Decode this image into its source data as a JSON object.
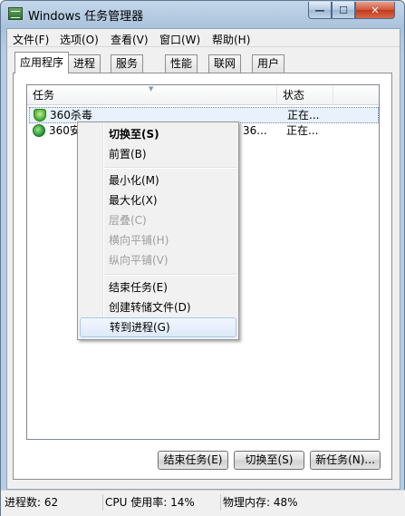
{
  "window": {
    "title": "Windows 任务管理器"
  },
  "caption_buttons": {
    "minimize": "—",
    "maximize": "☐",
    "close": "✕"
  },
  "menubar": [
    "文件(F)",
    "选项(O)",
    "查看(V)",
    "窗口(W)",
    "帮助(H)"
  ],
  "tabs": [
    "应用程序",
    "进程",
    "服务",
    "性能",
    "联网",
    "用户"
  ],
  "listview": {
    "columns": [
      "任务",
      "状态"
    ],
    "rows": [
      {
        "name": "360杀毒",
        "status": "正在...",
        "icon": "shield-icon"
      },
      {
        "name": "360安",
        "status": "正在...",
        "extra": "36...",
        "icon": "360-safe-icon"
      }
    ]
  },
  "context_menu": {
    "items": [
      {
        "label": "切换至(S)",
        "style": "bold"
      },
      {
        "label": "前置(B)"
      },
      {
        "label": "最小化(M)"
      },
      {
        "label": "最大化(X)"
      },
      {
        "label": "层叠(C)",
        "style": "disabled"
      },
      {
        "label": "横向平铺(H)",
        "style": "disabled"
      },
      {
        "label": "纵向平铺(V)",
        "style": "disabled"
      },
      {
        "label": "结束任务(E)"
      },
      {
        "label": "创建转储文件(D)"
      },
      {
        "label": "转到进程(G)",
        "style": "hover"
      }
    ]
  },
  "buttons": {
    "end_task": "结束任务(E)",
    "switch_to": "切换至(S)",
    "new_task": "新任务(N)..."
  },
  "statusbar": {
    "processes": "进程数: 62",
    "cpu": "CPU 使用率: 14%",
    "memory": "物理内存: 48%"
  }
}
